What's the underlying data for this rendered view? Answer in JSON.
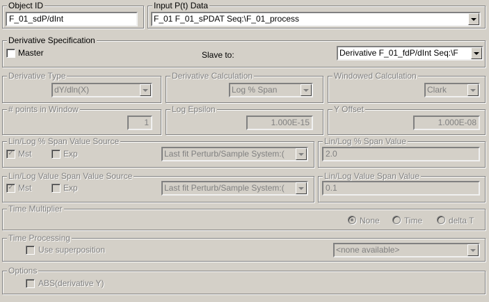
{
  "object_id": {
    "label": "Object ID",
    "value": "F_01_sdP/dInt"
  },
  "input_pt": {
    "label": "Input P(t) Data",
    "value": "F_01 F_01_sPDAT Seq:\\F_01_process"
  },
  "deriv_spec": {
    "title": "Derivative Specification",
    "master_label": "Master",
    "master_checked": false,
    "slave_label": "Slave to:",
    "slave_value": "Derivative F_01_fdP/dInt Seq:\\F"
  },
  "deriv_type": {
    "title": "Derivative Type",
    "value": "dY/dln(X)"
  },
  "deriv_calc": {
    "title": "Derivative Calculation",
    "value": "Log % Span"
  },
  "windowed_calc": {
    "title": "Windowed Calculation",
    "value": "Clark"
  },
  "points_window": {
    "title": "# points in Window",
    "value": "1"
  },
  "log_epsilon": {
    "title": "Log Epsilon",
    "value": "1.000E-15"
  },
  "y_offset": {
    "title": "Y Offset",
    "value": "1.000E-08"
  },
  "pct_span_source": {
    "title": "Lin/Log % Span Value Source",
    "mst_label": "Mst",
    "mst_checked": true,
    "exp_label": "Exp",
    "exp_checked": false,
    "value": "Last fit Perturb/Sample System:("
  },
  "pct_span_value": {
    "title": "Lin/Log % Span Value",
    "value": "2.0"
  },
  "val_span_source": {
    "title": "Lin/Log Value Span Value Source",
    "mst_label": "Mst",
    "mst_checked": true,
    "exp_label": "Exp",
    "exp_checked": false,
    "value": "Last fit Perturb/Sample System:("
  },
  "val_span_value": {
    "title": "Lin/Log Value Span Value",
    "value": "0.1"
  },
  "time_multiplier": {
    "title": "Time Multiplier",
    "options": [
      "None",
      "Time",
      "delta T"
    ],
    "selected": "None"
  },
  "time_processing": {
    "title": "Time Processing",
    "superposition_label": "Use superposition",
    "superposition_checked": false,
    "value": "<none available>"
  },
  "options": {
    "title": "Options",
    "abs_label": "ABS(derivative Y)",
    "abs_checked": false
  },
  "colors": {
    "face": "#d4d0c8",
    "shadow": "#808080",
    "highlight": "#ffffff",
    "disabled_text": "#808080"
  }
}
